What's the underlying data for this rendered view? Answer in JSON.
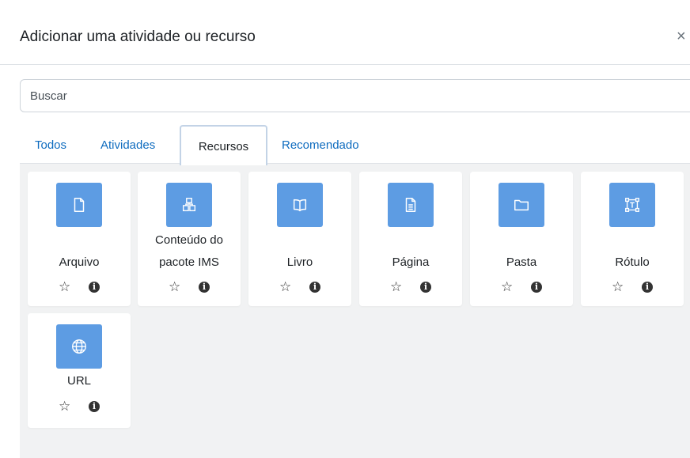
{
  "modal": {
    "title": "Adicionar uma atividade ou recurso",
    "close_label": "×"
  },
  "search": {
    "placeholder": "Buscar"
  },
  "tabs": [
    {
      "label": "Todos",
      "active": false
    },
    {
      "label": "Atividades",
      "active": false
    },
    {
      "label": "Recursos",
      "active": true
    },
    {
      "label": "Recomendado",
      "active": false
    }
  ],
  "items": [
    {
      "label": "Arquivo",
      "icon": "file-icon"
    },
    {
      "label_line1": "Conteúdo do",
      "label_line2": "pacote IMS",
      "icon": "package-icon"
    },
    {
      "label": "Livro",
      "icon": "book-icon"
    },
    {
      "label": "Página",
      "icon": "page-icon"
    },
    {
      "label": "Pasta",
      "icon": "folder-icon"
    },
    {
      "label": "Rótulo",
      "icon": "label-icon"
    },
    {
      "label": "URL",
      "icon": "globe-icon"
    }
  ],
  "actions": {
    "star": "☆",
    "info": "i"
  },
  "colors": {
    "accent": "#0f6cbf",
    "icon_bg": "#5d9ce3",
    "content_bg": "#f1f2f3"
  }
}
